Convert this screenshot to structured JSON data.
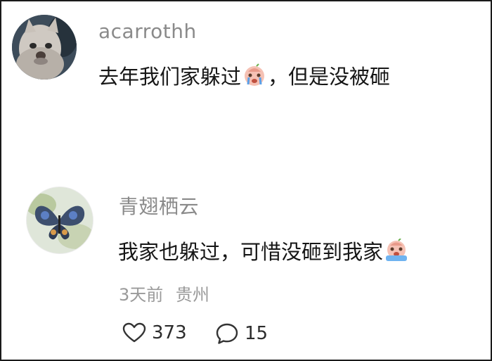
{
  "comment1": {
    "username": "acarrothh",
    "text_before": "去年我们家躲过",
    "text_after": "，但是没被砸",
    "emoji": "crying-face-emoji"
  },
  "comment2": {
    "username": "青翅栖云",
    "text_before": "我家也躲过，可惜没砸到我家",
    "emoji": "crying-face-emoji",
    "time": "3天前",
    "location": "贵州",
    "likes": "373",
    "replies": "15"
  },
  "icons": {
    "like": "heart-icon",
    "reply": "speech-bubble-icon"
  }
}
